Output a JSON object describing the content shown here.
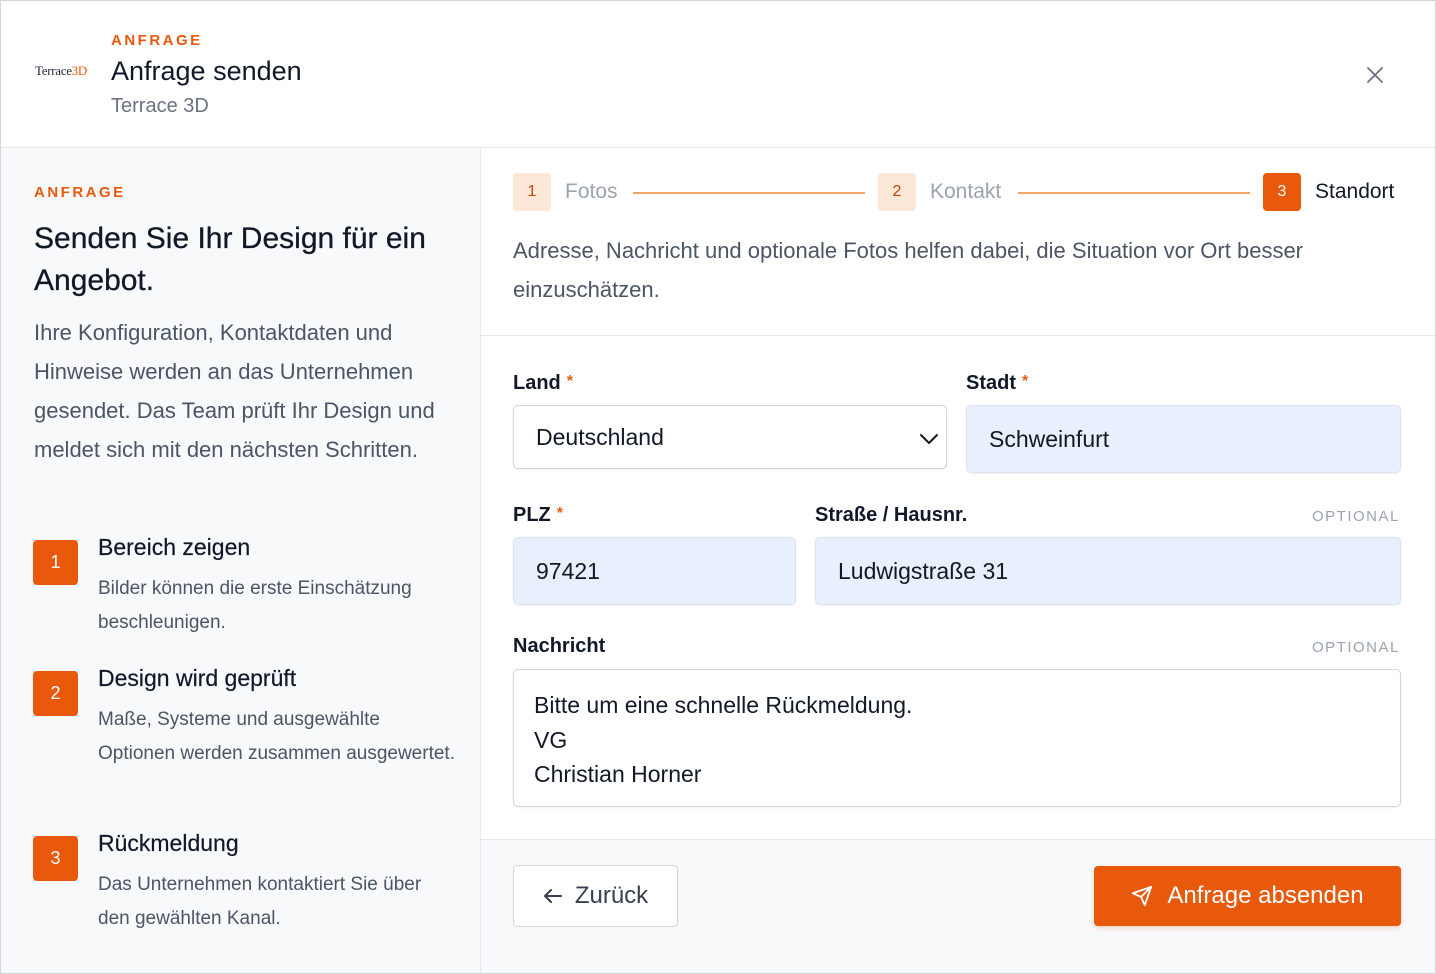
{
  "header": {
    "logo_text_main": "Terrace",
    "logo_text_accent": "3D",
    "eyebrow": "ANFRAGE",
    "title": "Anfrage senden",
    "subtitle": "Terrace 3D"
  },
  "sidebar": {
    "eyebrow": "ANFRAGE",
    "heading": "Senden Sie Ihr Design für ein Angebot.",
    "intro": "Ihre Konfiguration, Kontaktdaten und Hinweise werden an das Unternehmen gesendet. Das Team prüft Ihr Design und meldet sich mit den nächsten Schritten.",
    "steps": [
      {
        "num": "1",
        "title": "Bereich zeigen",
        "desc": "Bilder können die erste Einschätzung beschleunigen."
      },
      {
        "num": "2",
        "title": "Design wird geprüft",
        "desc": "Maße, Systeme und ausgewählte Optionen werden zusammen ausgewertet."
      },
      {
        "num": "3",
        "title": "Rückmeldung",
        "desc": "Das Unternehmen kontaktiert Sie über den gewählten Kanal."
      }
    ]
  },
  "stepper": {
    "steps": [
      {
        "num": "1",
        "label": "Fotos",
        "state": "done"
      },
      {
        "num": "2",
        "label": "Kontakt",
        "state": "done"
      },
      {
        "num": "3",
        "label": "Standort",
        "state": "active"
      }
    ]
  },
  "main": {
    "description": "Adresse, Nachricht und optionale Fotos helfen dabei, die Situation vor Ort besser einzuschätzen.",
    "required_marker": "*",
    "optional_label": "OPTIONAL",
    "fields": {
      "land": {
        "label": "Land",
        "value": "Deutschland"
      },
      "stadt": {
        "label": "Stadt",
        "value": "Schweinfurt"
      },
      "plz": {
        "label": "PLZ",
        "value": "97421"
      },
      "strasse": {
        "label": "Straße / Hausnr.",
        "value": "Ludwigstraße 31"
      },
      "nachricht": {
        "label": "Nachricht",
        "lines": [
          "Bitte um eine schnelle Rückmeldung.",
          "VG",
          "Christian Horner"
        ]
      }
    }
  },
  "footer": {
    "back_label": "Zurück",
    "submit_label": "Anfrage absenden"
  },
  "colors": {
    "accent": "#e8590c",
    "filled_input": "#e8effd",
    "sidebar_bg": "#f8f9fb"
  }
}
